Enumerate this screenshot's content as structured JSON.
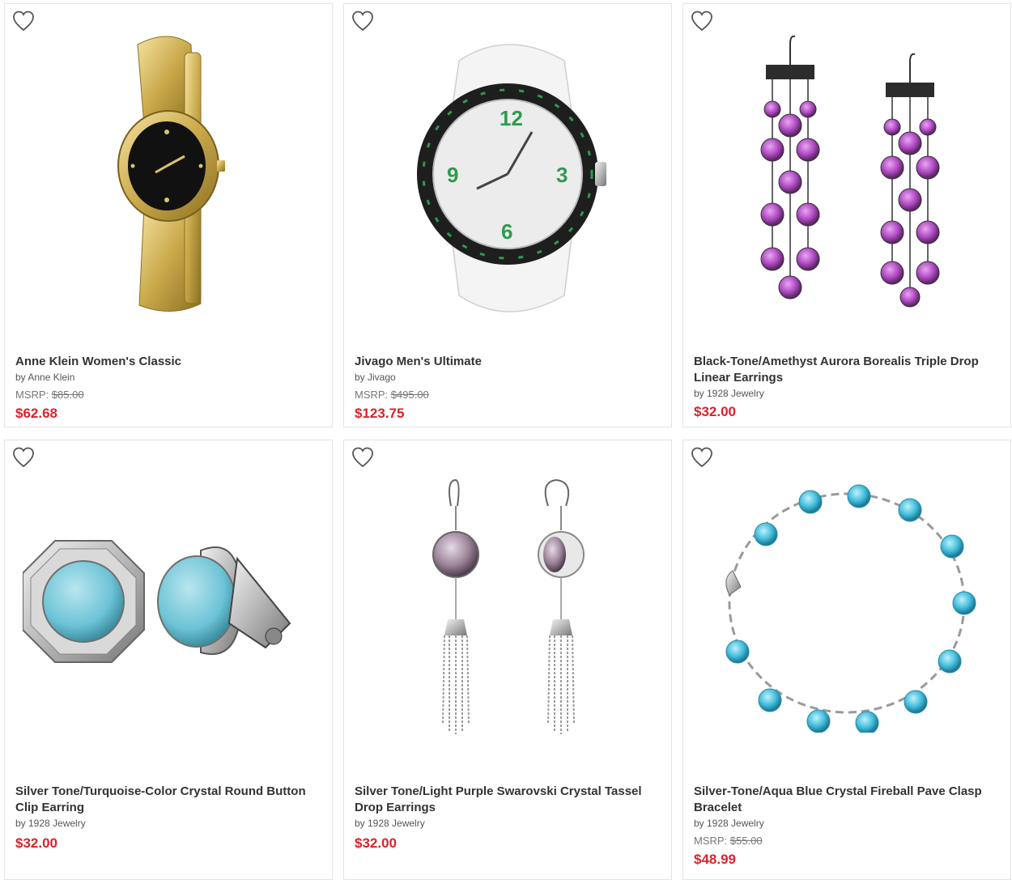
{
  "accent_price_color": "#d8232a",
  "products": [
    {
      "title": "Anne Klein Women's Classic",
      "brand": "by Anne Klein",
      "msrp_label": "MSRP:",
      "msrp": "$85.00",
      "price": "$62.68",
      "image_icon": "gold-watch-image",
      "wishlist_icon": "heart-icon"
    },
    {
      "title": "Jivago Men's Ultimate",
      "brand": "by Jivago",
      "msrp_label": "MSRP:",
      "msrp": "$495.00",
      "price": "$123.75",
      "image_icon": "white-watch-image",
      "wishlist_icon": "heart-icon"
    },
    {
      "title": "Black-Tone/Amethyst Aurora Borealis Triple Drop Linear Earrings",
      "brand": "by 1928 Jewelry",
      "price": "$32.00",
      "image_icon": "amethyst-earrings-image",
      "wishlist_icon": "heart-icon"
    },
    {
      "title": "Silver Tone/Turquoise-Color Crystal Round Button Clip Earring",
      "brand": "by 1928 Jewelry",
      "price": "$32.00",
      "image_icon": "turquoise-clip-earrings-image",
      "wishlist_icon": "heart-icon"
    },
    {
      "title": "Silver Tone/Light Purple Swarovski Crystal Tassel Drop Earrings",
      "brand": "by 1928 Jewelry",
      "price": "$32.00",
      "image_icon": "tassel-drop-earrings-image",
      "wishlist_icon": "heart-icon"
    },
    {
      "title": "Silver-Tone/Aqua Blue Crystal Fireball Pave Clasp Bracelet",
      "brand": "by 1928 Jewelry",
      "msrp_label": "MSRP:",
      "msrp": "$55.00",
      "price": "$48.99",
      "image_icon": "aqua-bracelet-image",
      "wishlist_icon": "heart-icon"
    }
  ]
}
